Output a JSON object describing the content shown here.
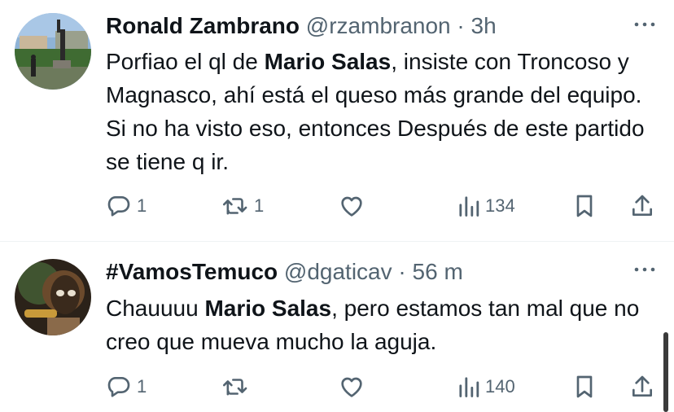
{
  "tweets": [
    {
      "name": "Ronald Zambrano",
      "handle": "@rzambranon",
      "separator": "·",
      "time": "3h",
      "text_parts": [
        "Porfiao el ql de ",
        "Mario Salas",
        ", insiste con Troncoso y Magnasco, ahí está el queso más grande del equipo. Si no ha visto eso, entonces Después de este partido se tiene q ir."
      ],
      "replies": "1",
      "retweets": "1",
      "likes": "",
      "views": "134"
    },
    {
      "name": "#VamosTemuco",
      "handle": "@dgaticav",
      "separator": "·",
      "time": "56 m",
      "text_parts": [
        "Chauuuu ",
        "Mario Salas",
        ", pero estamos tan mal que no creo que mueva mucho la aguja."
      ],
      "replies": "1",
      "retweets": "",
      "likes": "",
      "views": "140"
    }
  ],
  "icons": {
    "more": "more-icon",
    "reply": "reply-icon",
    "retweet": "retweet-icon",
    "like": "heart-icon",
    "views": "views-icon",
    "bookmark": "bookmark-icon",
    "share": "share-icon"
  },
  "colors": {
    "text": "#0f1419",
    "secondary": "#536471",
    "divider": "#eff3f4"
  }
}
